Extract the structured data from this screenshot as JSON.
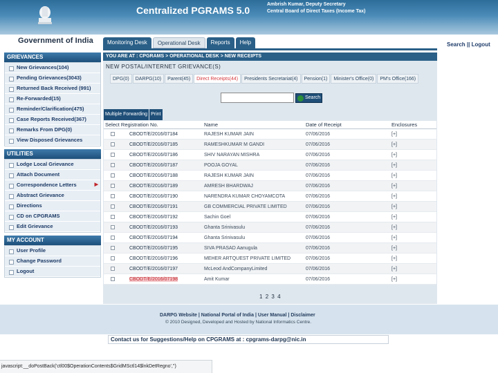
{
  "header": {
    "app_title": "Centralized PGRAMS 5.0",
    "officer_line1": "Ambrish Kumar, Deputy Secretary",
    "officer_line2": "Central Board of Direct Taxes (Income Tax)",
    "gov_label": "Government of India",
    "search_link": "Search",
    "separator": "||",
    "logout_link": "Logout"
  },
  "tabs": [
    {
      "label": "Monitoring Desk"
    },
    {
      "label": "Operational Desk"
    },
    {
      "label": "Reports"
    },
    {
      "label": "Help"
    }
  ],
  "sidebar": {
    "grievances": {
      "title": "GRIEVANCES",
      "items": [
        "New Grievances(104)",
        "Pending Grievances(3043)",
        "Returned Back Received (991)",
        "Re-Forwarded(15)",
        "Reminder/Clarification(475)",
        "Case Reports Received(367)",
        "Remarks From DPG(0)",
        "View Disposed Grievances"
      ]
    },
    "utilities": {
      "title": "UTILITIES",
      "items": [
        "Lodge Local Grievance",
        "Attach Document",
        "Correspondence Letters",
        "Abstract Grievance",
        "Directions",
        "CD on CPGRAMS",
        "Edit Grievance"
      ]
    },
    "account": {
      "title": "MY ACCOUNT",
      "items": [
        "User Profile",
        "Change Password",
        "Logout"
      ]
    }
  },
  "main": {
    "breadcrumb": "YOU ARE AT : CPGRAMS > OPERATIONAL DESK > NEW RECEIPTS",
    "section_title": "NEW POSTAL/INTERNET GRIEVANCE(S)",
    "subtabs": [
      "DPG(0)",
      "DARPG(10)",
      "Parent(45)",
      "Direct Receipts(44)",
      "Presidents Secretariat(4)",
      "Pension(1)",
      "Minister's Office(0)",
      "PM's Office(166)"
    ],
    "search_value": "",
    "search_button": "Search",
    "actions": [
      "Multiple Forwarding",
      "Print"
    ],
    "columns": [
      "Select Registration No.",
      "Name",
      "Date of Receipt",
      "Enclosures"
    ],
    "rows": [
      {
        "reg": "CBODT/E/2016/07184",
        "name": "RAJESH KUMAR JAIN",
        "date": "07/06/2016",
        "enc": "[+]"
      },
      {
        "reg": "CBODT/E/2016/07185",
        "name": "RAMESHKUMAR M GANDI",
        "date": "07/06/2016",
        "enc": "[+]"
      },
      {
        "reg": "CBODT/E/2016/07186",
        "name": "SHIV NARAYAN MISHRA",
        "date": "07/06/2016",
        "enc": "[+]"
      },
      {
        "reg": "CBODT/E/2016/07187",
        "name": "POOJA GOYAL",
        "date": "07/06/2016",
        "enc": "[+]"
      },
      {
        "reg": "CBODT/E/2016/07188",
        "name": "RAJESH KUMAR JAIN",
        "date": "07/06/2016",
        "enc": "[+]"
      },
      {
        "reg": "CBODT/E/2016/07189",
        "name": "AMRESH BHARDWAJ",
        "date": "07/06/2016",
        "enc": "[+]"
      },
      {
        "reg": "CBODT/E/2016/07190",
        "name": "NARENDRA KUMAR CHOYAMCOTA",
        "date": "07/06/2016",
        "enc": "[+]"
      },
      {
        "reg": "CBODT/E/2016/07191",
        "name": "GB COMMERCIAL PRIVATE LIMITED",
        "date": "07/06/2016",
        "enc": "[+]"
      },
      {
        "reg": "CBODT/E/2016/07192",
        "name": "Sachin Goel",
        "date": "07/06/2016",
        "enc": "[+]"
      },
      {
        "reg": "CBODT/E/2016/07193",
        "name": "Ghanta Srinivasulu",
        "date": "07/06/2016",
        "enc": "[+]"
      },
      {
        "reg": "CBODT/E/2016/07194",
        "name": "Ghanta Srinivasulu",
        "date": "07/06/2016",
        "enc": "[+]"
      },
      {
        "reg": "CBODT/E/2016/07195",
        "name": "SIVA PRASAD Aanugula",
        "date": "07/06/2016",
        "enc": "[+]"
      },
      {
        "reg": "CBODT/E/2016/07196",
        "name": "MEHER ARTQUEST PRIVATE LIMITED",
        "date": "07/06/2016",
        "enc": "[+]"
      },
      {
        "reg": "CBODT/E/2016/07197",
        "name": "McLeod AndCompanyLimited",
        "date": "07/06/2016",
        "enc": "[+]"
      },
      {
        "reg": "CBODT/E/2016/07198",
        "name": "Amit Kumar",
        "date": "07/06/2016",
        "enc": "[+]"
      }
    ],
    "pages": [
      "1",
      "2",
      "3",
      "4"
    ]
  },
  "footer": {
    "links": "DARPG Website | National Portal of India | User Manual | Disclaimer",
    "copyright": "© 2010 Designed, Developed and Hosted by National Informatics Centre.",
    "contact": "Contact us for Suggestions/Help on CPGRAMS at : cpgrams-darpg@nic.in"
  },
  "statusbar": "javascript:__doPostBack('ctl00$OperationContents$GridMSctl14$lnkDetRegno','')",
  "colors": {
    "header": "#2c6d9a",
    "nav": "#2a5f87",
    "selected_reg": "#c0262c"
  }
}
